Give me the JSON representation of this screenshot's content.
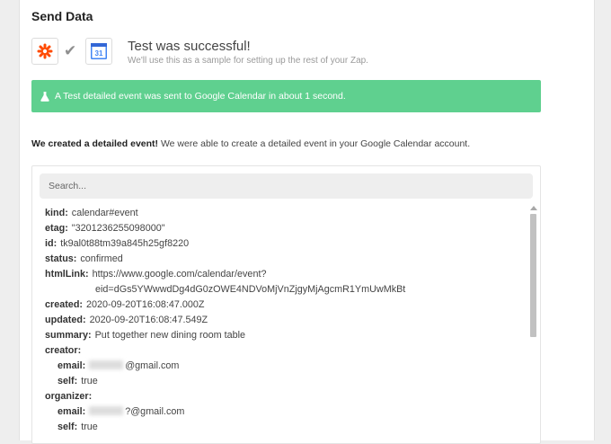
{
  "section_title": "Send Data",
  "test": {
    "title": "Test was successful!",
    "subtitle": "We'll use this as a sample for setting up the rest of your Zap."
  },
  "banner": {
    "text": "A Test detailed event was sent to Google Calendar in about 1 second.",
    "color": "#5fd08f"
  },
  "description": {
    "bold": "We created a detailed event!",
    "rest": " We were able to create a detailed event in your Google Calendar account."
  },
  "search": {
    "placeholder": "Search..."
  },
  "icons": {
    "app_left": "zapier-icon",
    "connector": "check-icon",
    "app_right": "google-calendar-icon",
    "calendar_day": "31",
    "banner": "flask-icon"
  },
  "fields": [
    {
      "key": "kind:",
      "value": "calendar#event"
    },
    {
      "key": "etag:",
      "value": "\"3201236255098000\""
    },
    {
      "key": "id:",
      "value": "tk9al0t88tm39a845h25gf8220"
    },
    {
      "key": "status:",
      "value": "confirmed"
    },
    {
      "key": "htmlLink:",
      "value": "https://www.google.com/calendar/event?"
    },
    {
      "key": "",
      "value": "eid=dGs5YWwwdDg4dG0zOWE4NDVoMjVnZjgyMjAgcmR1YmUwMkBt"
    },
    {
      "key": "created:",
      "value": "2020-09-20T16:08:47.000Z"
    },
    {
      "key": "updated:",
      "value": "2020-09-20T16:08:47.549Z"
    },
    {
      "key": "summary:",
      "value": "Put together new dining room table"
    },
    {
      "key": "creator:",
      "value": ""
    },
    {
      "key": "email:",
      "value": "@gmail.com"
    },
    {
      "key": "self:",
      "value": "true"
    },
    {
      "key": "organizer:",
      "value": ""
    },
    {
      "key": "email:",
      "value": "?@gmail.com"
    },
    {
      "key": "self:",
      "value": "true"
    }
  ]
}
